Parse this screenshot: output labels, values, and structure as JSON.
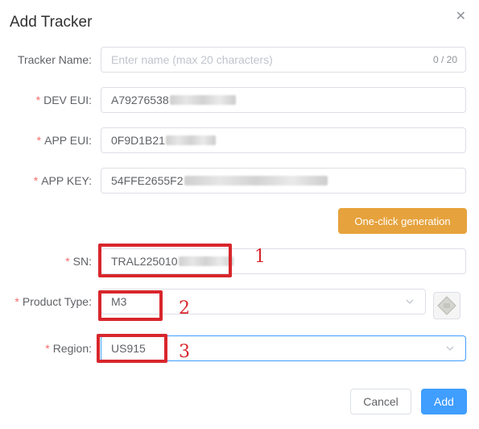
{
  "dialog": {
    "title": "Add Tracker"
  },
  "fields": {
    "tracker_name": {
      "label": "Tracker Name:",
      "placeholder": "Enter name (max 20 characters)",
      "count": "0 / 20"
    },
    "dev_eui": {
      "label": "DEV EUI:",
      "value": "A79276538"
    },
    "app_eui": {
      "label": "APP EUI:",
      "value": "0F9D1B21"
    },
    "app_key": {
      "label": "APP KEY:",
      "value": "54FFE2655F2"
    },
    "sn": {
      "label": "SN:",
      "value": "TRAL225010"
    },
    "product_type": {
      "label": "Product Type:",
      "value": "M3"
    },
    "region": {
      "label": "Region:",
      "value": "US915"
    }
  },
  "required_mark": "*",
  "buttons": {
    "generate": "One-click generation",
    "cancel": "Cancel",
    "add": "Add"
  },
  "annotations": [
    "1",
    "2",
    "3"
  ],
  "colors": {
    "accent": "#409eff",
    "warning": "#e6a23c",
    "annotation": "#d8262c",
    "required": "#f56c6c"
  }
}
